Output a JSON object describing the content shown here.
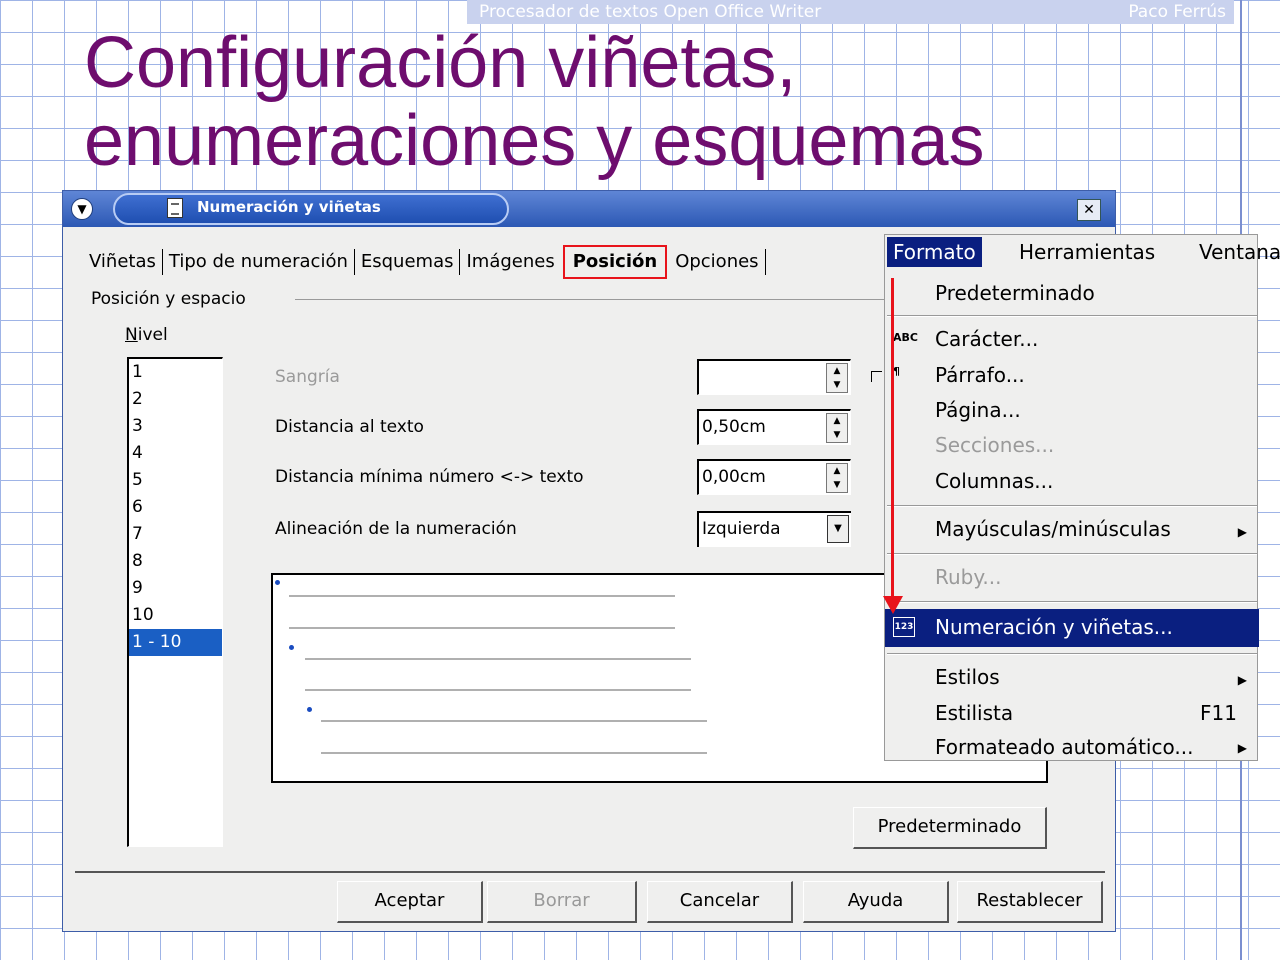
{
  "slide": {
    "header_left": "Procesador de textos Open Office Writer",
    "header_right": "Paco Ferrús",
    "title_line1": "Configuración viñetas,",
    "title_line2": "enumeraciones y esquemas"
  },
  "dialog": {
    "title": "Numeración y viñetas",
    "tabs": [
      "Viñetas",
      "Tipo de numeración",
      "Esquemas",
      "Imágenes",
      "Posición",
      "Opciones"
    ],
    "active_tab": "Posición",
    "group_label": "Posición y espacio",
    "nivel_label": "Nivel",
    "nivel_items": [
      "1",
      "2",
      "3",
      "4",
      "5",
      "6",
      "7",
      "8",
      "9",
      "10",
      "1 - 10"
    ],
    "selected_nivel": "1 - 10",
    "sangria_label": "Sangría",
    "sangria_value": "",
    "distancia_label": "Distancia al texto",
    "distancia_value": "0,50cm",
    "minima_label": "Distancia mínima número <-> texto",
    "minima_value": "0,00cm",
    "alineacion_label": "Alineación de la numeración",
    "alineacion_value": "Izquierda",
    "predeterminado_button": "Predeterminado",
    "buttons": {
      "aceptar": "Aceptar",
      "borrar": "Borrar",
      "cancelar": "Cancelar",
      "ayuda": "Ayuda",
      "restablecer": "Restablecer"
    }
  },
  "menu": {
    "bar": [
      "Formato",
      "Herramientas",
      "Ventana"
    ],
    "items": {
      "predeterminado": "Predeterminado",
      "caracter": "Carácter...",
      "parrafo": "Párrafo...",
      "pagina": "Página...",
      "secciones": "Secciones...",
      "columnas": "Columnas...",
      "mayusculas": "Mayúsculas/minúsculas",
      "ruby": "Ruby...",
      "numeracion": "Numeración y viñetas...",
      "estilos": "Estilos",
      "estilista": "Estilista",
      "estilista_shortcut": "F11",
      "formateado": "Formateado automático..."
    }
  },
  "colors": {
    "title": "#6e0d6e",
    "highlight": "#e8131b",
    "menu_selection": "#0a1f80",
    "list_selection": "#1a5fc4"
  }
}
